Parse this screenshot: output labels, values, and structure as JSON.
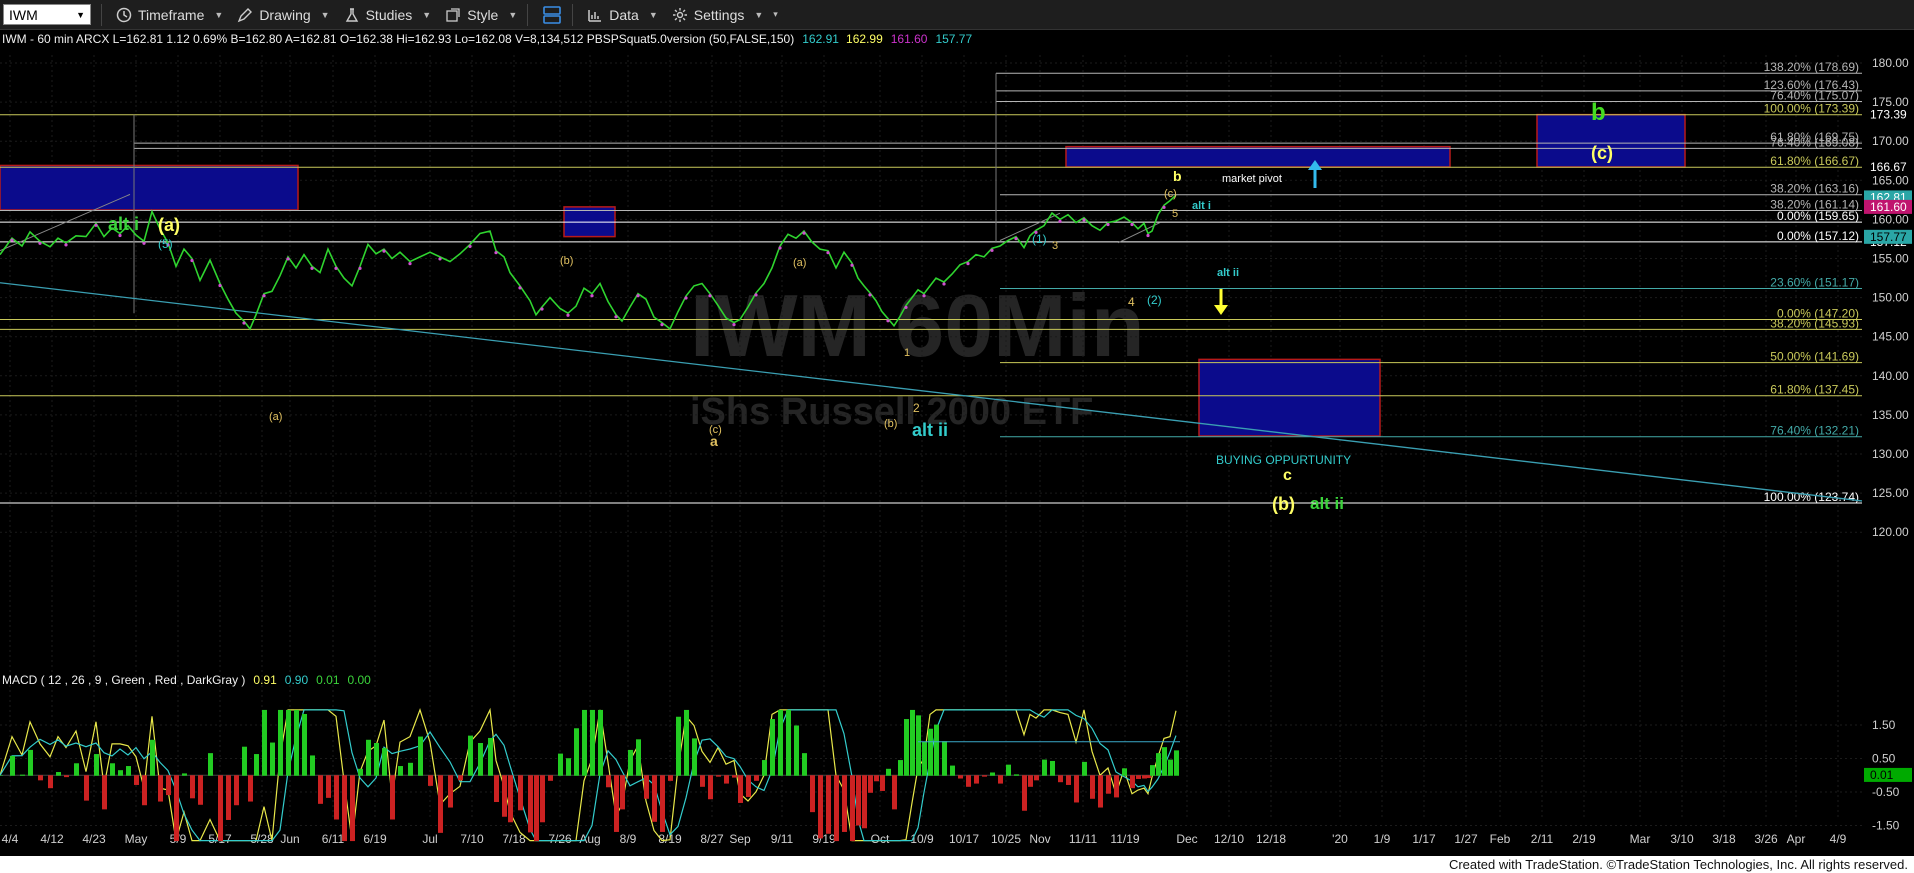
{
  "toolbar": {
    "symbol": "IWM",
    "items": [
      "Timeframe",
      "Drawing",
      "Studies",
      "Style",
      "Data",
      "Settings"
    ]
  },
  "header": {
    "prefix": "IWM - 60 min  ARCX  L=162.81  1.12  0.69%  B=162.80  A=162.81  O=162.38  Hi=162.93  Lo=162.08  V=8,134,512  PBSPSquat5.0version (50,FALSE,150)",
    "v1": "162.91",
    "v2": "162.99",
    "v3": "161.60",
    "v4": "157.77"
  },
  "watermark": {
    "line1": "IWM 60Min",
    "line2": "iShs Russell 2000 ETF"
  },
  "chart_data": [
    {
      "type": "line",
      "title": "IWM - 60 min",
      "x_ticks": [
        "4/4",
        "4/12",
        "4/23",
        "May",
        "5/9",
        "5/17",
        "5/28",
        "Jun",
        "6/11",
        "6/19",
        "Jul",
        "7/10",
        "7/18",
        "7/26",
        "Aug",
        "8/9",
        "8/19",
        "8/27",
        "Sep",
        "9/11",
        "9/19",
        "Oct",
        "10/9",
        "10/17",
        "10/25",
        "Nov",
        "11/11",
        "11/19",
        "Dec",
        "12/10",
        "12/18",
        "'20",
        "1/9",
        "1/17",
        "1/27",
        "Feb",
        "2/11",
        "2/19",
        "Mar",
        "3/10",
        "3/18",
        "3/26",
        "Apr",
        "4/9"
      ],
      "y_ticks": [
        "180.00",
        "175.00",
        "170.00",
        "165.00",
        "160.00",
        "155.00",
        "150.00",
        "145.00",
        "140.00",
        "135.00",
        "130.00",
        "125.00",
        "120.00"
      ],
      "ylim": [
        116.5,
        182.4
      ],
      "price_path": [
        [
          0,
          155.5
        ],
        [
          12,
          157.6
        ],
        [
          22,
          156.6
        ],
        [
          30,
          158.4
        ],
        [
          40,
          157.2
        ],
        [
          50,
          156.5
        ],
        [
          58,
          157.6
        ],
        [
          66,
          157.0
        ],
        [
          76,
          157.9
        ],
        [
          86,
          157.8
        ],
        [
          96,
          159.5
        ],
        [
          104,
          157.8
        ],
        [
          112,
          158.9
        ],
        [
          120,
          158.2
        ],
        [
          128,
          159.2
        ],
        [
          136,
          158.0
        ],
        [
          144,
          157.2
        ],
        [
          152,
          161.0
        ],
        [
          160,
          158.8
        ],
        [
          168,
          157.0
        ],
        [
          176,
          154.0
        ],
        [
          184,
          156.2
        ],
        [
          192,
          155.0
        ],
        [
          200,
          152.2
        ],
        [
          210,
          154.8
        ],
        [
          220,
          151.8
        ],
        [
          228,
          149.8
        ],
        [
          236,
          148.0
        ],
        [
          244,
          147.0
        ],
        [
          250,
          146.0
        ],
        [
          256,
          147.8
        ],
        [
          264,
          150.5
        ],
        [
          272,
          150.8
        ],
        [
          280,
          152.8
        ],
        [
          288,
          155.2
        ],
        [
          296,
          153.8
        ],
        [
          304,
          155.5
        ],
        [
          312,
          154.0
        ],
        [
          320,
          153.2
        ],
        [
          328,
          156.2
        ],
        [
          336,
          154.0
        ],
        [
          344,
          152.5
        ],
        [
          352,
          151.5
        ],
        [
          360,
          154.0
        ],
        [
          368,
          156.8
        ],
        [
          376,
          155.6
        ],
        [
          384,
          156.2
        ],
        [
          392,
          155.0
        ],
        [
          400,
          155.8
        ],
        [
          410,
          154.6
        ],
        [
          420,
          155.2
        ],
        [
          430,
          155.8
        ],
        [
          440,
          155.2
        ],
        [
          450,
          154.6
        ],
        [
          460,
          155.6
        ],
        [
          470,
          156.8
        ],
        [
          480,
          158.2
        ],
        [
          490,
          158.5
        ],
        [
          496,
          156.0
        ],
        [
          504,
          155.2
        ],
        [
          510,
          153.2
        ],
        [
          520,
          151.5
        ],
        [
          530,
          149.6
        ],
        [
          536,
          147.8
        ],
        [
          542,
          148.8
        ],
        [
          550,
          150.0
        ],
        [
          560,
          148.6
        ],
        [
          568,
          148.0
        ],
        [
          576,
          148.9
        ],
        [
          584,
          151.2
        ],
        [
          592,
          150.5
        ],
        [
          600,
          151.8
        ],
        [
          608,
          149.5
        ],
        [
          616,
          147.8
        ],
        [
          622,
          147.0
        ],
        [
          630,
          148.8
        ],
        [
          638,
          150.5
        ],
        [
          646,
          149.8
        ],
        [
          654,
          147.5
        ],
        [
          662,
          146.8
        ],
        [
          670,
          146.0
        ],
        [
          678,
          148.2
        ],
        [
          686,
          150.2
        ],
        [
          694,
          151.5
        ],
        [
          702,
          151.8
        ],
        [
          710,
          150.5
        ],
        [
          718,
          149.0
        ],
        [
          726,
          147.4
        ],
        [
          734,
          146.8
        ],
        [
          740,
          147.2
        ],
        [
          748,
          148.8
        ],
        [
          756,
          150.6
        ],
        [
          764,
          151.8
        ],
        [
          772,
          153.8
        ],
        [
          780,
          156.6
        ],
        [
          788,
          158.1
        ],
        [
          796,
          157.6
        ],
        [
          804,
          158.5
        ],
        [
          812,
          157.1
        ],
        [
          820,
          156.2
        ],
        [
          828,
          156.0
        ],
        [
          836,
          153.8
        ],
        [
          844,
          155.8
        ],
        [
          852,
          154.4
        ],
        [
          858,
          152.5
        ],
        [
          864,
          151.5
        ],
        [
          870,
          150.6
        ],
        [
          876,
          149.6
        ],
        [
          882,
          148.2
        ],
        [
          888,
          147.3
        ],
        [
          894,
          146.4
        ],
        [
          900,
          147.6
        ],
        [
          906,
          149.0
        ],
        [
          912,
          150.0
        ],
        [
          918,
          151.0
        ],
        [
          924,
          150.5
        ],
        [
          930,
          151.5
        ],
        [
          936,
          152.5
        ],
        [
          944,
          152.0
        ],
        [
          952,
          153.0
        ],
        [
          960,
          154.2
        ],
        [
          968,
          154.6
        ],
        [
          976,
          155.5
        ],
        [
          984,
          155.2
        ],
        [
          992,
          156.3
        ],
        [
          1000,
          156.6
        ],
        [
          1008,
          157.3
        ],
        [
          1016,
          157.8
        ],
        [
          1024,
          156.4
        ],
        [
          1030,
          157.9
        ],
        [
          1036,
          158.6
        ],
        [
          1044,
          159.2
        ],
        [
          1052,
          160.8
        ],
        [
          1060,
          160.0
        ],
        [
          1068,
          160.6
        ],
        [
          1076,
          159.6
        ],
        [
          1084,
          160.2
        ],
        [
          1092,
          159.2
        ],
        [
          1100,
          158.6
        ],
        [
          1108,
          159.6
        ],
        [
          1116,
          159.8
        ],
        [
          1124,
          160.3
        ],
        [
          1132,
          159.6
        ],
        [
          1138,
          158.8
        ],
        [
          1144,
          159.5
        ],
        [
          1148,
          158.2
        ],
        [
          1152,
          158.5
        ],
        [
          1158,
          160.6
        ],
        [
          1164,
          161.8
        ],
        [
          1170,
          162.4
        ],
        [
          1176,
          163.1
        ]
      ],
      "horizontal_levels": [
        {
          "label": "138.20%",
          "value": 178.69,
          "color": "#b5b5b5"
        },
        {
          "label": "123.60%",
          "value": 176.43,
          "color": "#b5b5b5"
        },
        {
          "label": "76.40%",
          "value": 175.07,
          "color": "#b5b5b5"
        },
        {
          "label": "100.00%",
          "value": 173.39,
          "color": "#c9c95a"
        },
        {
          "label": "61.80%",
          "value": 169.75,
          "color": "#b5b5b5"
        },
        {
          "label": "76.40%",
          "value": 169.08,
          "color": "#b5b5b5"
        },
        {
          "label": "61.80%",
          "value": 166.67,
          "color": "#c9c95a"
        },
        {
          "label": "38.20%",
          "value": 163.16,
          "color": "#b5b5b5"
        },
        {
          "label": "38.20%",
          "value": 161.14,
          "color": "#b5b5b5"
        },
        {
          "label": "0.00%",
          "value": 159.65,
          "color": "#ffffff"
        },
        {
          "label": "0.00%",
          "value": 157.12,
          "color": "#ffffff"
        },
        {
          "label": "23.60%",
          "value": 151.17,
          "color": "#43aaa8"
        },
        {
          "label": "0.00%",
          "value": 147.2,
          "color": "#c9c95a"
        },
        {
          "label": "38.20%",
          "value": 145.93,
          "color": "#c9c95a"
        },
        {
          "label": "50.00%",
          "value": 141.69,
          "color": "#c9c95a"
        },
        {
          "label": "61.80%",
          "value": 137.45,
          "color": "#c9c95a"
        },
        {
          "label": "76.40%",
          "value": 132.21,
          "color": "#43aaa8"
        },
        {
          "label": "100.00%",
          "value": 123.74,
          "color": "#ffffff"
        }
      ],
      "price_badges": [
        {
          "text": "173.39",
          "bg": "#000000",
          "fg": "#ffffff"
        },
        {
          "text": "166.67",
          "bg": "#000000",
          "fg": "#ffffff"
        },
        {
          "text": "162.81",
          "bg": "#2aa6a6",
          "fg": "#ffffff"
        },
        {
          "text": "161.60",
          "bg": "#c0146e",
          "fg": "#ffffff"
        },
        {
          "text": "157.12",
          "bg": "#000000",
          "fg": "#ffffff"
        },
        {
          "text": "157.77",
          "bg": "#2aa6a6",
          "fg": "#000000"
        }
      ],
      "annotations": [
        {
          "text": "alt i",
          "color": "#3bd43b",
          "size": 18,
          "bold": true
        },
        {
          "text": "(a)",
          "color": "#ffff66",
          "size": 18,
          "bold": true
        },
        {
          "text": "(5)",
          "color": "#33cccc",
          "size": 12
        },
        {
          "text": "(b)",
          "color": "#e0c060",
          "size": 11
        },
        {
          "text": "(a)",
          "color": "#e0c060",
          "size": 11
        },
        {
          "text": "(a)",
          "color": "#e0c060",
          "size": 11
        },
        {
          "text": "(c)",
          "color": "#e0c060",
          "size": 11
        },
        {
          "text": "a",
          "color": "#e0c060",
          "size": 14,
          "bold": true
        },
        {
          "text": "(b)",
          "color": "#e0c060",
          "size": 11
        },
        {
          "text": "1",
          "color": "#e0c060",
          "size": 11
        },
        {
          "text": "2",
          "color": "#e0c060",
          "size": 12
        },
        {
          "text": "alt ii",
          "color": "#33cccc",
          "size": 18,
          "bold": true
        },
        {
          "text": "(1)",
          "color": "#33cccc",
          "size": 12
        },
        {
          "text": "3",
          "color": "#e0c060",
          "size": 11
        },
        {
          "text": "4",
          "color": "#e0c060",
          "size": 12
        },
        {
          "text": "(2)",
          "color": "#33cccc",
          "size": 12
        },
        {
          "text": "b",
          "color": "#ffff66",
          "size": 14,
          "bold": true
        },
        {
          "text": "(c)",
          "color": "#e0c060",
          "size": 11
        },
        {
          "text": "5",
          "color": "#e0c060",
          "size": 11
        },
        {
          "text": "alt i",
          "color": "#33cccc",
          "size": 11,
          "bold": true
        },
        {
          "text": "alt ii",
          "color": "#33cccc",
          "size": 11,
          "bold": true
        },
        {
          "text": "market pivot",
          "color": "#ffffff",
          "size": 11
        },
        {
          "text": "b",
          "color": "#44dd22",
          "size": 24,
          "bold": true
        },
        {
          "text": "(c)",
          "color": "#ffff66",
          "size": 18,
          "bold": true
        },
        {
          "text": "BUYING OPPURTUNITY",
          "color": "#33cccc",
          "size": 12
        },
        {
          "text": "c",
          "color": "#ffff66",
          "size": 16,
          "bold": true
        },
        {
          "text": "(b)",
          "color": "#ffff66",
          "size": 18,
          "bold": true
        },
        {
          "text": "alt ii",
          "color": "#3bd43b",
          "size": 17,
          "bold": true
        }
      ]
    },
    {
      "type": "line",
      "title": "MACD ( 12 , 26 , 9 , Green , Red , DarkGray )",
      "values_label": [
        "0.91",
        "0.90",
        "0.01",
        "0.00"
      ],
      "values_colors": [
        "#ffff66",
        "#33cccc",
        "#3bd43b",
        "#3bd43b"
      ],
      "y_ticks": [
        "1.50",
        "0.50",
        "-0.50",
        "-1.50"
      ],
      "ylim": [
        -2.0,
        2.0
      ],
      "badge": {
        "text": "0.01",
        "bg": "#00aa00",
        "fg": "#000000"
      }
    }
  ],
  "footer": "Created with TradeStation. ©TradeStation Technologies, Inc. All rights reserved."
}
